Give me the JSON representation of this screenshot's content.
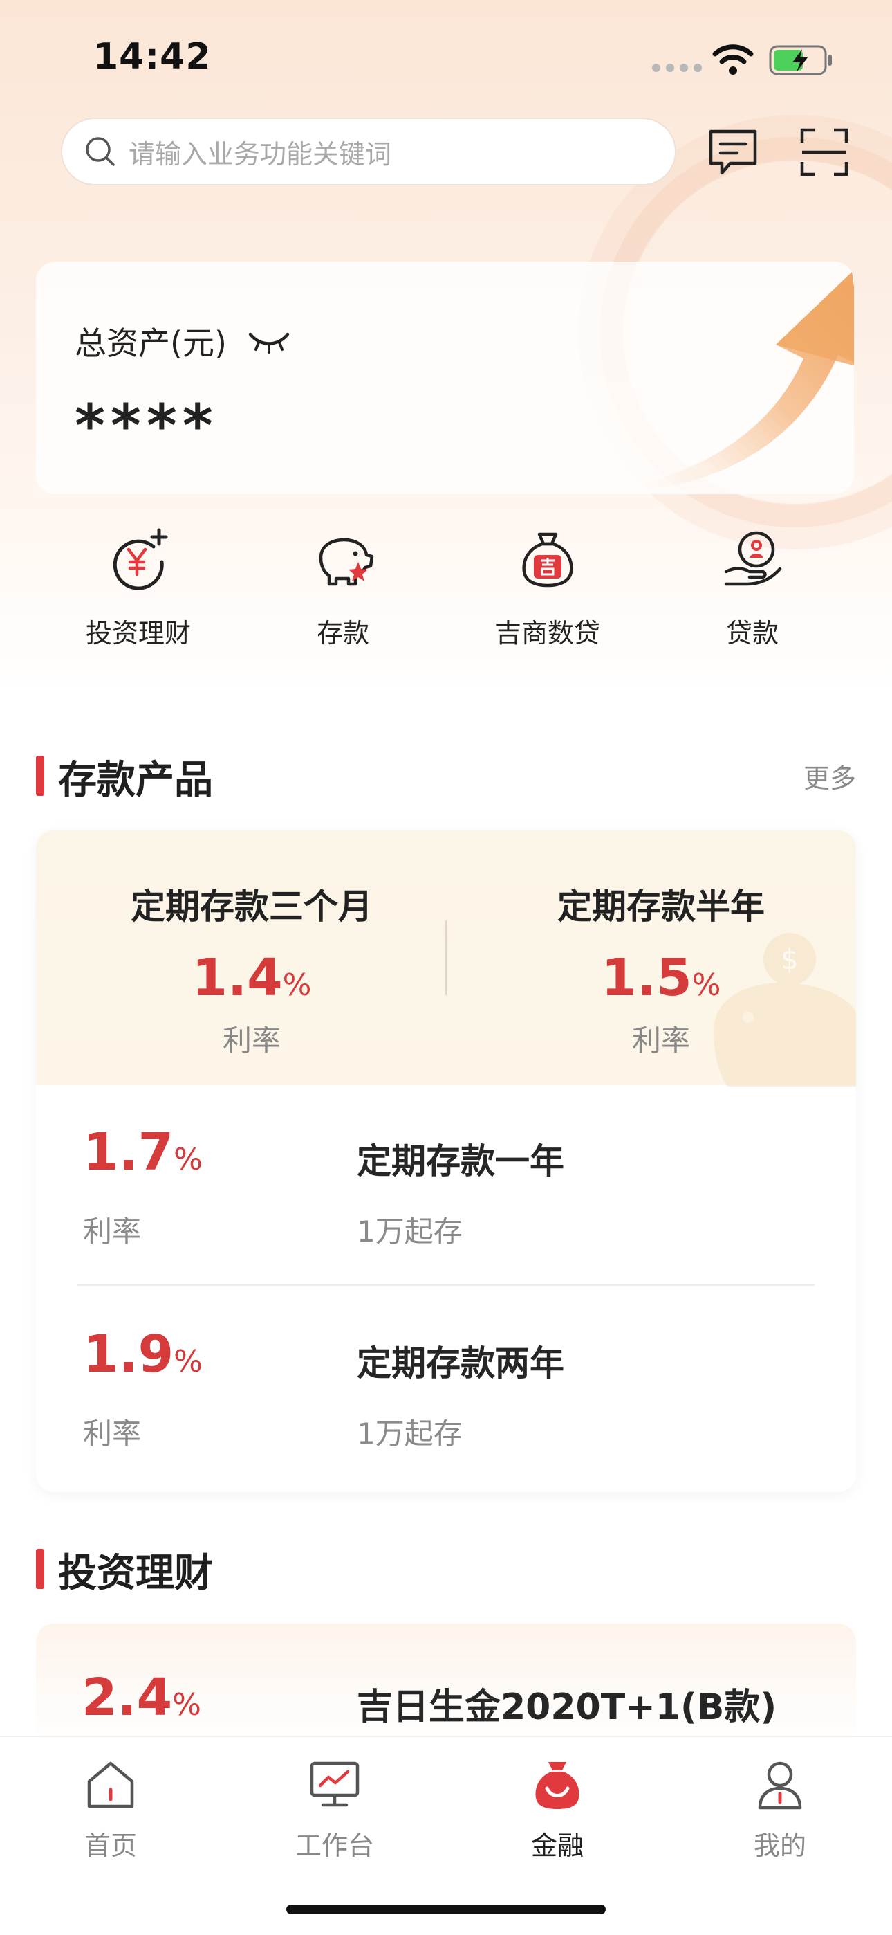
{
  "status_bar": {
    "time": "14:42"
  },
  "search": {
    "placeholder": "请输入业务功能关键词"
  },
  "asset": {
    "label": "总资产(元)",
    "value": "****"
  },
  "quick_nav": [
    {
      "label": "投资理财",
      "icon": "investment-yen-icon"
    },
    {
      "label": "存款",
      "icon": "piggy-bank-icon"
    },
    {
      "label": "吉商数贷",
      "icon": "money-bag-icon"
    },
    {
      "label": "贷款",
      "icon": "loan-hand-icon"
    }
  ],
  "deposit_section": {
    "title": "存款产品",
    "more": "更多",
    "featured": [
      {
        "name": "定期存款三个月",
        "rate": "1.4",
        "unit": "%",
        "rate_label": "利率"
      },
      {
        "name": "定期存款半年",
        "rate": "1.5",
        "unit": "%",
        "rate_label": "利率"
      }
    ],
    "rows": [
      {
        "rate": "1.7",
        "unit": "%",
        "rate_label": "利率",
        "name": "定期存款一年",
        "min": "1万起存"
      },
      {
        "rate": "1.9",
        "unit": "%",
        "rate_label": "利率",
        "name": "定期存款两年",
        "min": "1万起存"
      }
    ]
  },
  "invest_section": {
    "title": "投资理财",
    "product": {
      "rate": "2.4",
      "unit": "%",
      "name": "吉日生金2020T+1(B款)"
    }
  },
  "tabbar": [
    {
      "label": "首页",
      "icon": "home-icon",
      "active": false
    },
    {
      "label": "工作台",
      "icon": "workbench-monitor-icon",
      "active": false
    },
    {
      "label": "金融",
      "icon": "finance-bag-icon",
      "active": true
    },
    {
      "label": "我的",
      "icon": "user-icon",
      "active": false
    }
  ],
  "colors": {
    "accent": "#d63b3b",
    "section_bar": "#e03a3e",
    "muted": "#8a8a8a"
  }
}
